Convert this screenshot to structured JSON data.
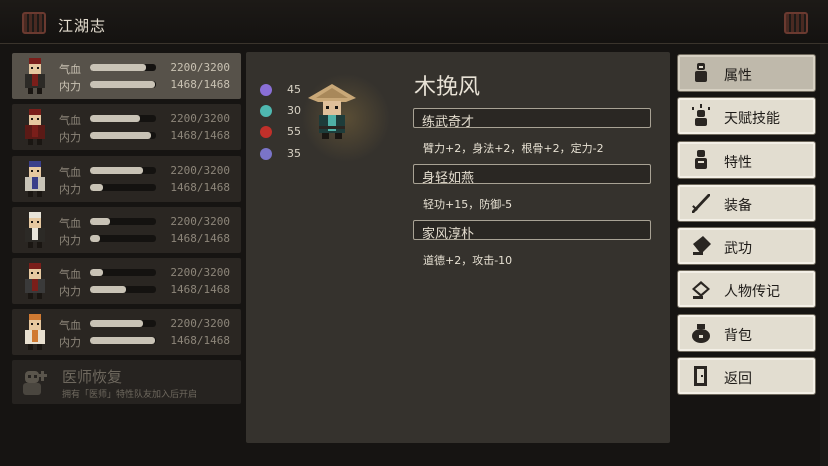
{
  "header": {
    "title": "江湖志"
  },
  "party": [
    {
      "hp_label": "气血",
      "mp_label": "内力",
      "hp_text": "2200/3200",
      "mp_text": "1468/1468",
      "hp_ratio": 0.85,
      "mp_ratio": 0.98,
      "selected": true
    },
    {
      "hp_label": "气血",
      "mp_label": "内力",
      "hp_text": "2200/3200",
      "mp_text": "1468/1468",
      "hp_ratio": 0.75,
      "mp_ratio": 0.92,
      "selected": false
    },
    {
      "hp_label": "气血",
      "mp_label": "内力",
      "hp_text": "2200/3200",
      "mp_text": "1468/1468",
      "hp_ratio": 0.8,
      "mp_ratio": 0.2,
      "selected": false
    },
    {
      "hp_label": "气血",
      "mp_label": "内力",
      "hp_text": "2200/3200",
      "mp_text": "1468/1468",
      "hp_ratio": 0.3,
      "mp_ratio": 0.15,
      "selected": false
    },
    {
      "hp_label": "气血",
      "mp_label": "内力",
      "hp_text": "2200/3200",
      "mp_text": "1468/1468",
      "hp_ratio": 0.2,
      "mp_ratio": 0.55,
      "selected": false
    },
    {
      "hp_label": "气血",
      "mp_label": "内力",
      "hp_text": "2200/3200",
      "mp_text": "1468/1468",
      "hp_ratio": 0.8,
      "mp_ratio": 0.98,
      "selected": false
    }
  ],
  "healer": {
    "name": "医师恢复",
    "desc": "拥有「医师」特性队友加入后开启"
  },
  "detail": {
    "stats": [
      {
        "icon": "purple-skull-icon",
        "value": "45",
        "color": "#8a6fd6"
      },
      {
        "icon": "teal-skull-icon",
        "value": "30",
        "color": "#4fb8b0"
      },
      {
        "icon": "red-orb-icon",
        "value": "55",
        "color": "#c0302a"
      },
      {
        "icon": "violet-orb-icon",
        "value": "35",
        "color": "#7a74c8"
      }
    ],
    "name": "木挽风",
    "traits": [
      {
        "title": "练武奇才",
        "desc": "臂力+2，身法+2，根骨+2，定力-2"
      },
      {
        "title": "身轻如燕",
        "desc": "轻功+15，防御-5"
      },
      {
        "title": "家风淳朴",
        "desc": "道德+2，攻击-10"
      }
    ]
  },
  "menu": [
    {
      "label": "属性",
      "icon": "person-icon",
      "active": true
    },
    {
      "label": "天赋技能",
      "icon": "talent-icon",
      "active": false
    },
    {
      "label": "特性",
      "icon": "trait-person-icon",
      "active": false
    },
    {
      "label": "装备",
      "icon": "sword-icon",
      "active": false
    },
    {
      "label": "武功",
      "icon": "martial-book-icon",
      "active": false
    },
    {
      "label": "人物传记",
      "icon": "biography-book-icon",
      "active": false
    },
    {
      "label": "背包",
      "icon": "bag-icon",
      "active": false
    },
    {
      "label": "返回",
      "icon": "return-door-icon",
      "active": false
    }
  ]
}
